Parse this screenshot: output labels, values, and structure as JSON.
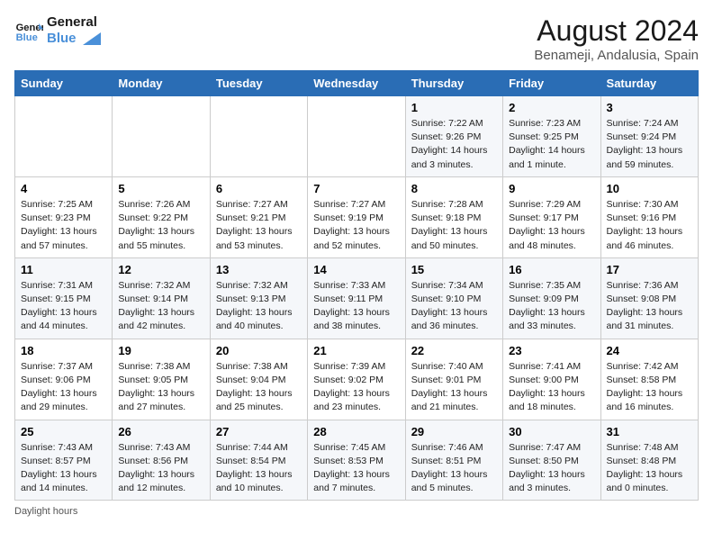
{
  "header": {
    "logo_text_general": "General",
    "logo_text_blue": "Blue",
    "month_year": "August 2024",
    "location": "Benameji, Andalusia, Spain"
  },
  "days_of_week": [
    "Sunday",
    "Monday",
    "Tuesday",
    "Wednesday",
    "Thursday",
    "Friday",
    "Saturday"
  ],
  "weeks": [
    [
      {
        "day": "",
        "info": ""
      },
      {
        "day": "",
        "info": ""
      },
      {
        "day": "",
        "info": ""
      },
      {
        "day": "",
        "info": ""
      },
      {
        "day": "1",
        "info": "Sunrise: 7:22 AM\nSunset: 9:26 PM\nDaylight: 14 hours\nand 3 minutes."
      },
      {
        "day": "2",
        "info": "Sunrise: 7:23 AM\nSunset: 9:25 PM\nDaylight: 14 hours\nand 1 minute."
      },
      {
        "day": "3",
        "info": "Sunrise: 7:24 AM\nSunset: 9:24 PM\nDaylight: 13 hours\nand 59 minutes."
      }
    ],
    [
      {
        "day": "4",
        "info": "Sunrise: 7:25 AM\nSunset: 9:23 PM\nDaylight: 13 hours\nand 57 minutes."
      },
      {
        "day": "5",
        "info": "Sunrise: 7:26 AM\nSunset: 9:22 PM\nDaylight: 13 hours\nand 55 minutes."
      },
      {
        "day": "6",
        "info": "Sunrise: 7:27 AM\nSunset: 9:21 PM\nDaylight: 13 hours\nand 53 minutes."
      },
      {
        "day": "7",
        "info": "Sunrise: 7:27 AM\nSunset: 9:19 PM\nDaylight: 13 hours\nand 52 minutes."
      },
      {
        "day": "8",
        "info": "Sunrise: 7:28 AM\nSunset: 9:18 PM\nDaylight: 13 hours\nand 50 minutes."
      },
      {
        "day": "9",
        "info": "Sunrise: 7:29 AM\nSunset: 9:17 PM\nDaylight: 13 hours\nand 48 minutes."
      },
      {
        "day": "10",
        "info": "Sunrise: 7:30 AM\nSunset: 9:16 PM\nDaylight: 13 hours\nand 46 minutes."
      }
    ],
    [
      {
        "day": "11",
        "info": "Sunrise: 7:31 AM\nSunset: 9:15 PM\nDaylight: 13 hours\nand 44 minutes."
      },
      {
        "day": "12",
        "info": "Sunrise: 7:32 AM\nSunset: 9:14 PM\nDaylight: 13 hours\nand 42 minutes."
      },
      {
        "day": "13",
        "info": "Sunrise: 7:32 AM\nSunset: 9:13 PM\nDaylight: 13 hours\nand 40 minutes."
      },
      {
        "day": "14",
        "info": "Sunrise: 7:33 AM\nSunset: 9:11 PM\nDaylight: 13 hours\nand 38 minutes."
      },
      {
        "day": "15",
        "info": "Sunrise: 7:34 AM\nSunset: 9:10 PM\nDaylight: 13 hours\nand 36 minutes."
      },
      {
        "day": "16",
        "info": "Sunrise: 7:35 AM\nSunset: 9:09 PM\nDaylight: 13 hours\nand 33 minutes."
      },
      {
        "day": "17",
        "info": "Sunrise: 7:36 AM\nSunset: 9:08 PM\nDaylight: 13 hours\nand 31 minutes."
      }
    ],
    [
      {
        "day": "18",
        "info": "Sunrise: 7:37 AM\nSunset: 9:06 PM\nDaylight: 13 hours\nand 29 minutes."
      },
      {
        "day": "19",
        "info": "Sunrise: 7:38 AM\nSunset: 9:05 PM\nDaylight: 13 hours\nand 27 minutes."
      },
      {
        "day": "20",
        "info": "Sunrise: 7:38 AM\nSunset: 9:04 PM\nDaylight: 13 hours\nand 25 minutes."
      },
      {
        "day": "21",
        "info": "Sunrise: 7:39 AM\nSunset: 9:02 PM\nDaylight: 13 hours\nand 23 minutes."
      },
      {
        "day": "22",
        "info": "Sunrise: 7:40 AM\nSunset: 9:01 PM\nDaylight: 13 hours\nand 21 minutes."
      },
      {
        "day": "23",
        "info": "Sunrise: 7:41 AM\nSunset: 9:00 PM\nDaylight: 13 hours\nand 18 minutes."
      },
      {
        "day": "24",
        "info": "Sunrise: 7:42 AM\nSunset: 8:58 PM\nDaylight: 13 hours\nand 16 minutes."
      }
    ],
    [
      {
        "day": "25",
        "info": "Sunrise: 7:43 AM\nSunset: 8:57 PM\nDaylight: 13 hours\nand 14 minutes."
      },
      {
        "day": "26",
        "info": "Sunrise: 7:43 AM\nSunset: 8:56 PM\nDaylight: 13 hours\nand 12 minutes."
      },
      {
        "day": "27",
        "info": "Sunrise: 7:44 AM\nSunset: 8:54 PM\nDaylight: 13 hours\nand 10 minutes."
      },
      {
        "day": "28",
        "info": "Sunrise: 7:45 AM\nSunset: 8:53 PM\nDaylight: 13 hours\nand 7 minutes."
      },
      {
        "day": "29",
        "info": "Sunrise: 7:46 AM\nSunset: 8:51 PM\nDaylight: 13 hours\nand 5 minutes."
      },
      {
        "day": "30",
        "info": "Sunrise: 7:47 AM\nSunset: 8:50 PM\nDaylight: 13 hours\nand 3 minutes."
      },
      {
        "day": "31",
        "info": "Sunrise: 7:48 AM\nSunset: 8:48 PM\nDaylight: 13 hours\nand 0 minutes."
      }
    ]
  ],
  "footer": {
    "note": "Daylight hours"
  }
}
